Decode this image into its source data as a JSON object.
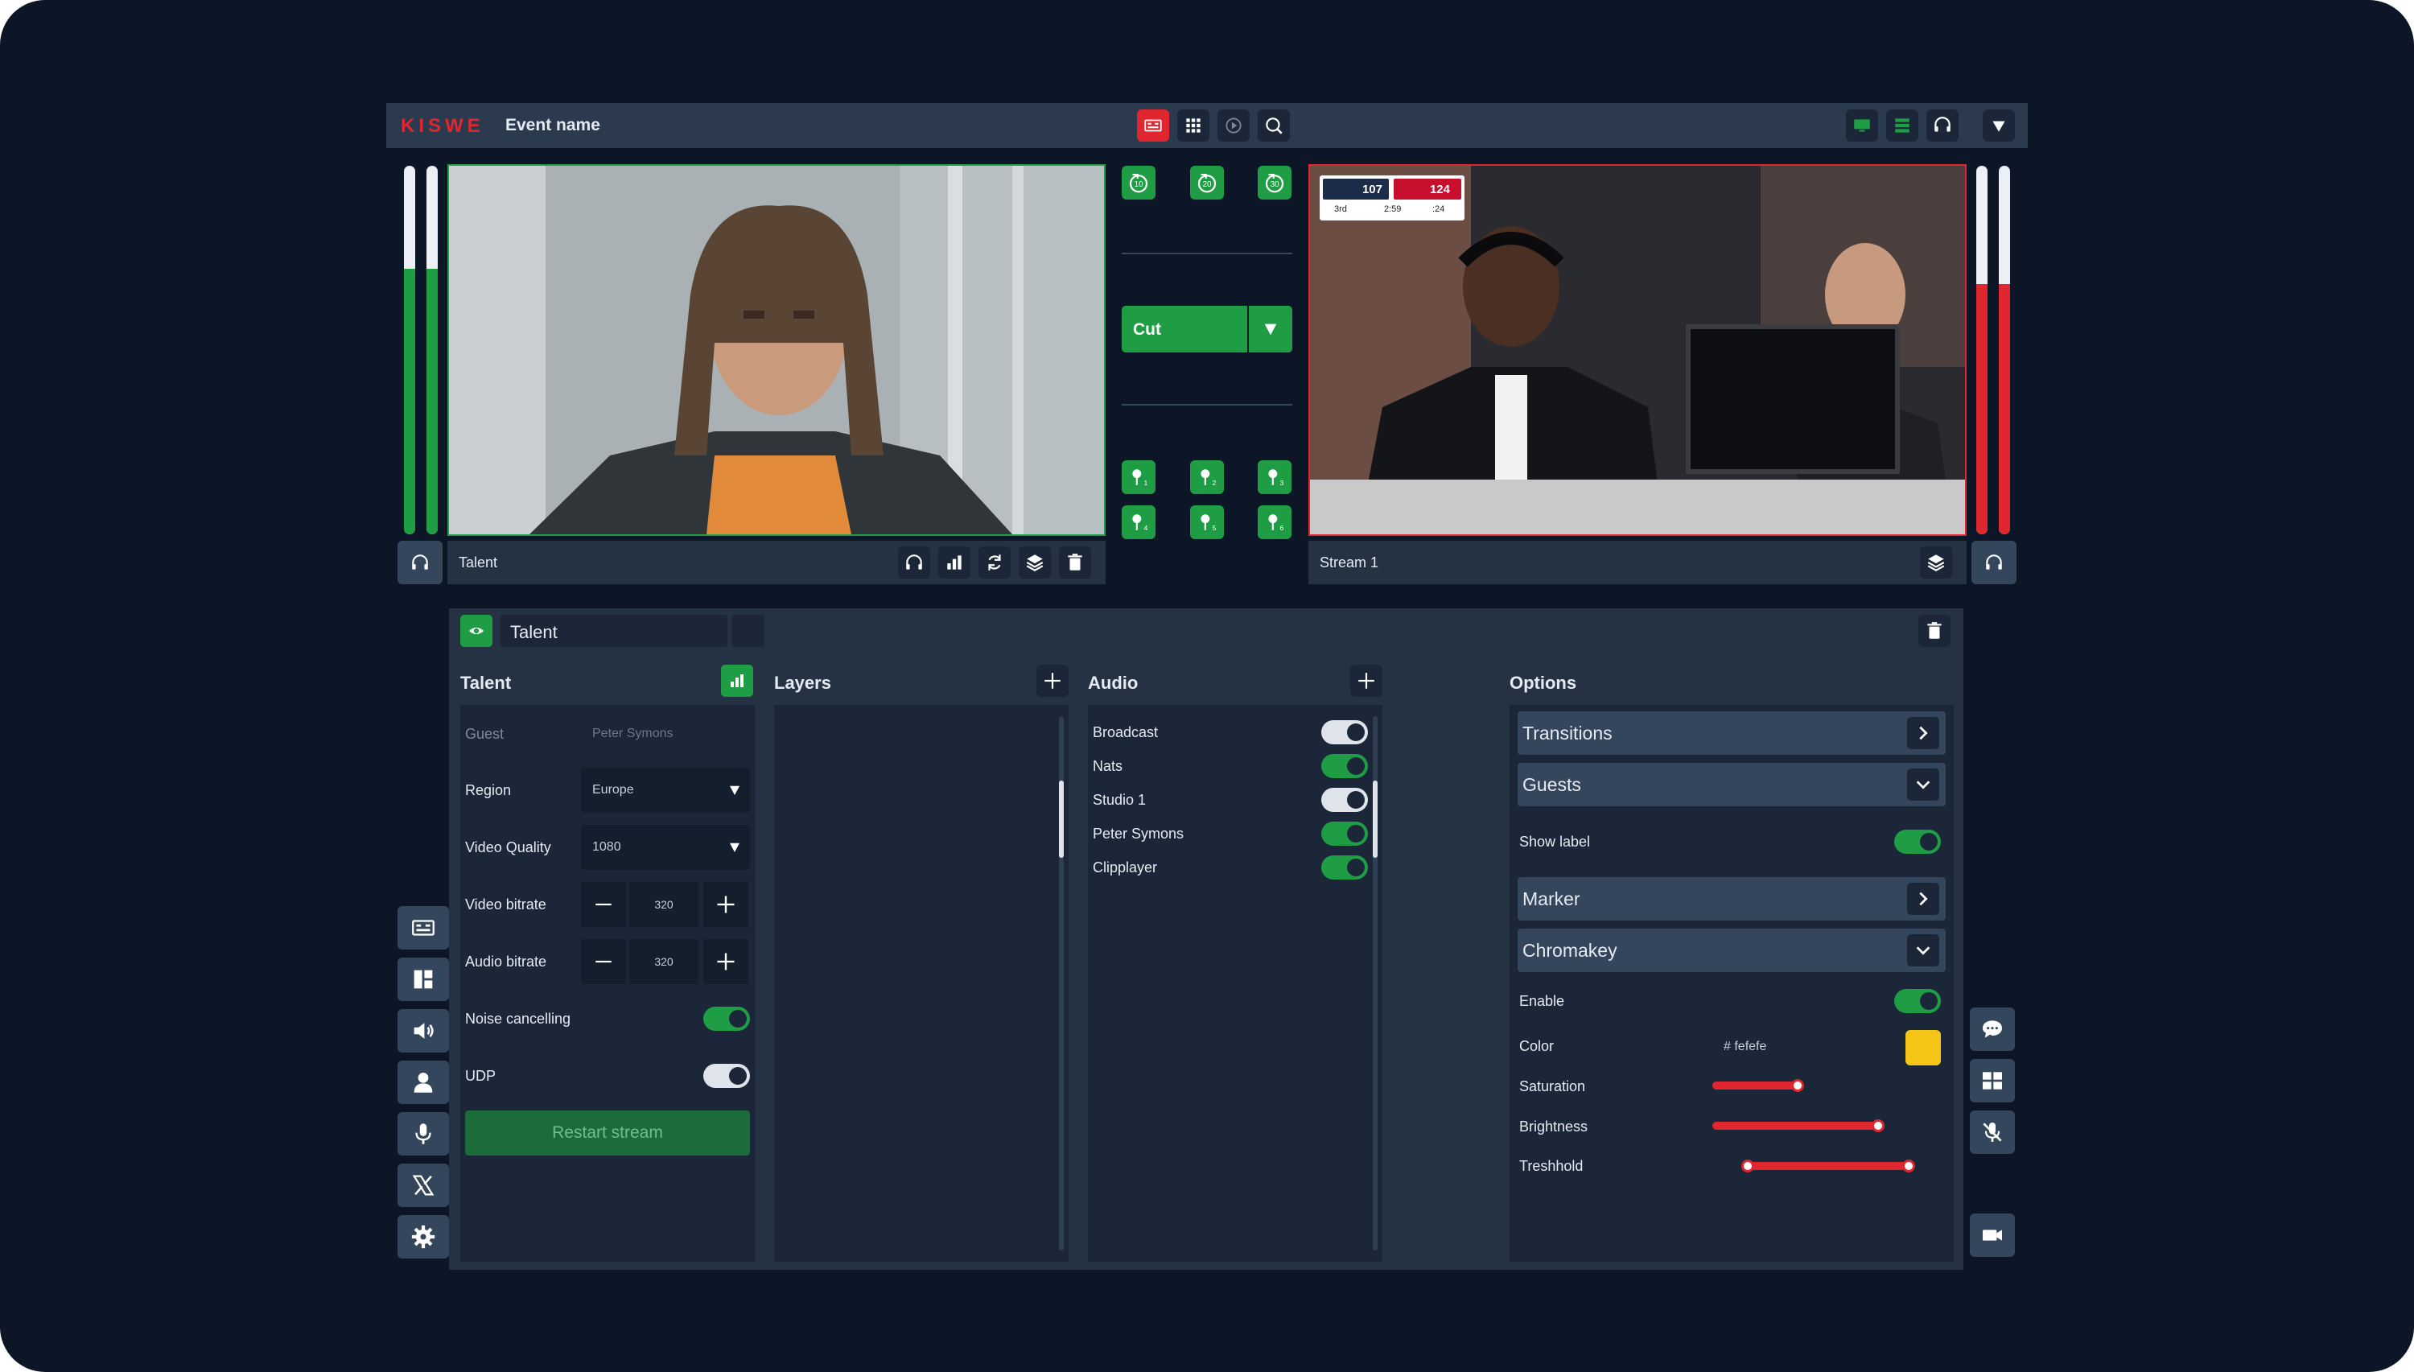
{
  "app": {
    "brand": "KISWE",
    "event_name": "Event name"
  },
  "colors": {
    "accent_green": "#1f9d45",
    "accent_red": "#e0262f",
    "chroma_color": "#f5c518"
  },
  "sources": {
    "left": {
      "label": "Talent",
      "audio_level": 0.72
    },
    "right": {
      "label": "Stream 1",
      "audio_level": 0.68
    },
    "scorebug": {
      "home_score": "107",
      "away_score": "124",
      "quarter": "3rd",
      "clock": "2:59",
      "shot_clock": ":24"
    }
  },
  "center": {
    "rewind_buttons": [
      "10",
      "20",
      "30"
    ],
    "cut_label": "Cut",
    "markers": [
      "1",
      "2",
      "3",
      "4",
      "5",
      "6"
    ]
  },
  "editor": {
    "title": "Talent",
    "talent": {
      "header": "Talent",
      "guest_label": "Guest",
      "guest_placeholder": "Peter Symons",
      "region_label": "Region",
      "region_value": "Europe",
      "quality_label": "Video Quality",
      "quality_value": "1080",
      "video_bitrate_label": "Video bitrate",
      "video_bitrate_value": "320",
      "audio_bitrate_label": "Audio bitrate",
      "audio_bitrate_value": "320",
      "noise_label": "Noise cancelling",
      "noise_on": true,
      "udp_label": "UDP",
      "udp_on": false,
      "restart_label": "Restart stream"
    },
    "layers": {
      "header": "Layers"
    },
    "audio": {
      "header": "Audio",
      "channels": [
        {
          "name": "Broadcast",
          "on": false
        },
        {
          "name": "Nats",
          "on": true
        },
        {
          "name": "Studio 1",
          "on": false
        },
        {
          "name": "Peter Symons",
          "on": true
        },
        {
          "name": "Clipplayer",
          "on": true
        }
      ]
    },
    "options": {
      "header": "Options",
      "transitions": "Transitions",
      "guests": "Guests",
      "show_label": "Show label",
      "show_label_on": true,
      "marker": "Marker",
      "chromakey": "Chromakey",
      "enable": "Enable",
      "enable_on": true,
      "color_label": "Color",
      "color_value": "# fefefe",
      "saturation_label": "Saturation",
      "saturation": 0.27,
      "brightness_label": "Brightness",
      "brightness": 0.76,
      "threshold_label": "Treshhold",
      "threshold_min": 0.15,
      "threshold_max": 0.93
    }
  }
}
